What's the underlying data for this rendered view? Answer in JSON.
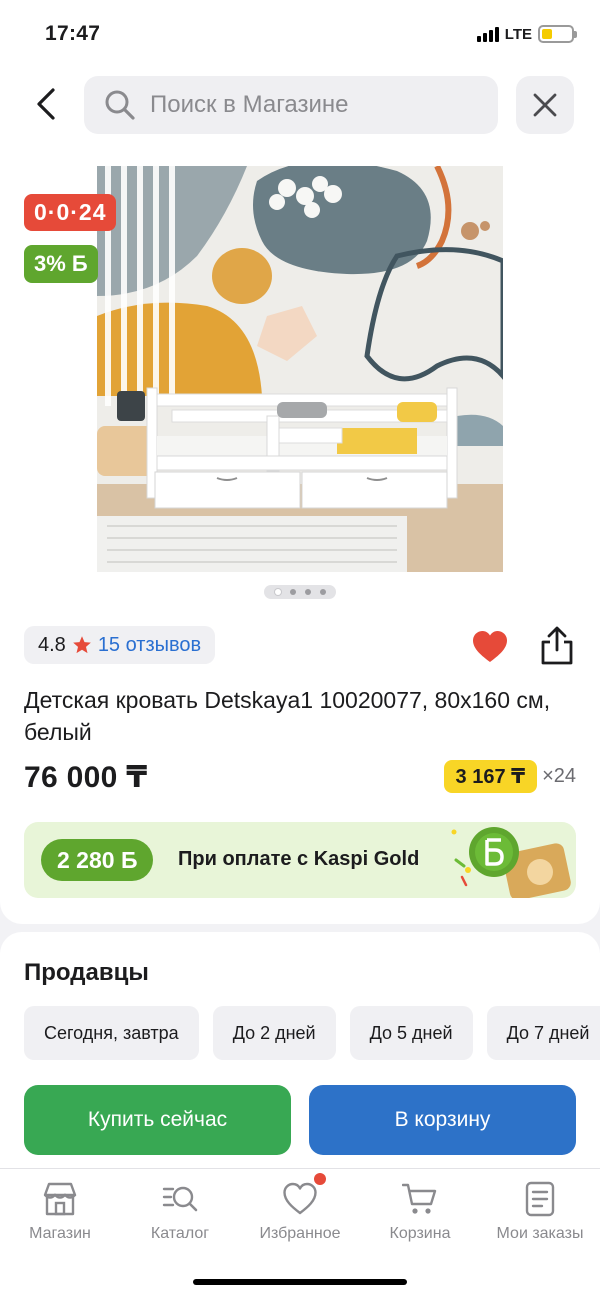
{
  "status_bar": {
    "time": "17:47",
    "network": "LTE"
  },
  "search": {
    "placeholder": "Поиск в Магазине"
  },
  "product": {
    "installment_badge": "0·0·24",
    "bonus_badge": "3% Б",
    "rating": "4.8",
    "reviews": "15 отзывов",
    "title": "Детская кровать Detskaya1 10020077, 80x160 см, белый",
    "price": "76 000 ₸",
    "monthly_price": "3 167 ₸",
    "monthly_times": "×24",
    "image_count": 4,
    "active_image": 1
  },
  "kaspi_banner": {
    "bonus": "2 280 Б",
    "text": "При оплате с Kaspi Gold"
  },
  "sellers": {
    "title": "Продавцы",
    "delivery_filters": [
      "Сегодня, завтра",
      "До 2 дней",
      "До 5 дней",
      "До 7 дней"
    ]
  },
  "actions": {
    "buy_now": "Купить сейчас",
    "to_cart": "В корзину"
  },
  "tab_bar": [
    {
      "label": "Магазин",
      "icon": "store-icon"
    },
    {
      "label": "Каталог",
      "icon": "catalog-icon"
    },
    {
      "label": "Избранное",
      "icon": "heart-outline-icon"
    },
    {
      "label": "Корзина",
      "icon": "cart-icon"
    },
    {
      "label": "Мои заказы",
      "icon": "orders-icon"
    }
  ],
  "colors": {
    "installment": "#e64a39",
    "bonus_green": "#5fa62e",
    "buy_green": "#38a853",
    "cart_blue": "#2d72c8",
    "monthly_yellow": "#f8d526",
    "link_blue": "#2a6fd1"
  }
}
